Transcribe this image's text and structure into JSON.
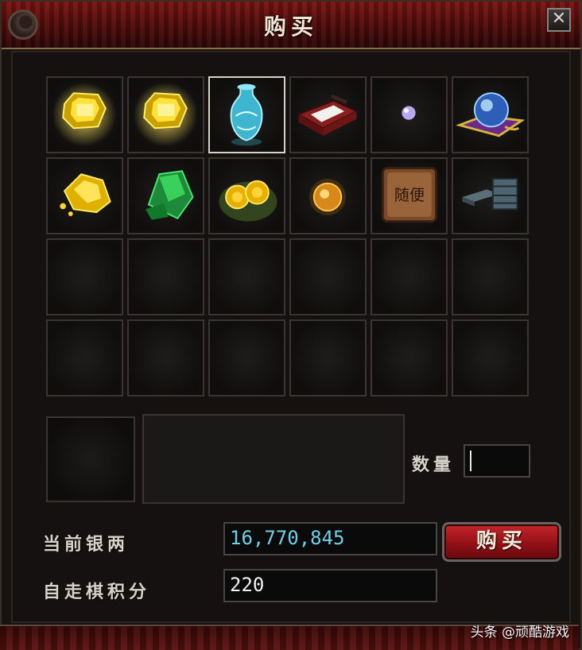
{
  "window": {
    "title": "购买",
    "close_glyph": "✕"
  },
  "items": [
    {
      "name": "yellow-gem-icon",
      "filled": true
    },
    {
      "name": "yellow-gem-icon",
      "filled": true
    },
    {
      "name": "jade-vase-icon",
      "filled": true,
      "selected": true
    },
    {
      "name": "red-box-icon",
      "filled": true
    },
    {
      "name": "pearl-icon",
      "filled": true
    },
    {
      "name": "crystal-ball-icon",
      "filled": true
    },
    {
      "name": "gold-nugget-icon",
      "filled": true
    },
    {
      "name": "green-crystal-icon",
      "filled": true
    },
    {
      "name": "gold-coins-icon",
      "filled": true
    },
    {
      "name": "orange-orb-icon",
      "filled": true
    },
    {
      "name": "token-block-icon",
      "filled": true,
      "text": "随便"
    },
    {
      "name": "books-icon",
      "filled": true
    }
  ],
  "empty_slots": 12,
  "quantity": {
    "label": "数量",
    "value": ""
  },
  "silver": {
    "label": "当前银两",
    "value": "16,770,845"
  },
  "points": {
    "label": "自走棋积分",
    "value": "220"
  },
  "buy_button": {
    "label": "购买"
  },
  "watermark": "头条 @顽酷游戏",
  "colors": {
    "title_bar": "#6a1411",
    "silver_value": "#6fd0e8",
    "button": "#b01c21"
  }
}
